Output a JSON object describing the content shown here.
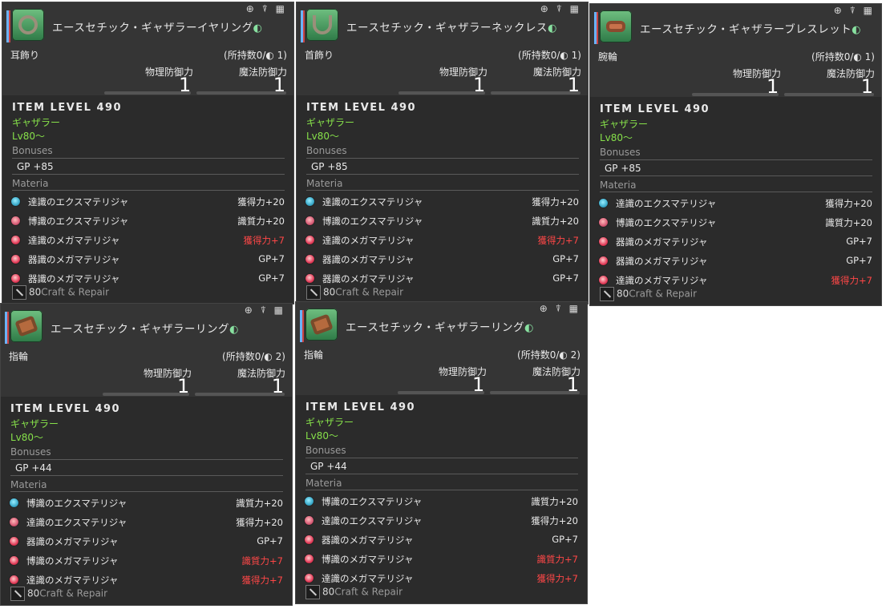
{
  "labels": {
    "phys_def": "物理防御力",
    "mag_def": "魔法防御力",
    "item_level": "ITEM LEVEL 490",
    "bonuses": "Bonuses",
    "materia": "Materia",
    "craft": "Craft & Repair",
    "tools": "⊕ ⍒ ▦"
  },
  "cards": [
    {
      "name": "エースセチック・ギャザラーイヤリング",
      "hq": "◐",
      "slot": "耳飾り",
      "owned": "(所持数0/◐ 1)",
      "phys_value": "1",
      "mag_value": "1",
      "job": "ギャザラー",
      "level": "Lv80～",
      "bonus": "GP +85",
      "craft_level": "80",
      "materia": [
        {
          "name": "達識のエクスマテリジャ",
          "value": "獲得力+20",
          "color": "blue",
          "warn": false
        },
        {
          "name": "博識のエクスマテリジャ",
          "value": "識質力+20",
          "color": "pink",
          "warn": false
        },
        {
          "name": "達識のメガマテリジャ",
          "value": "獲得力+7",
          "color": "red",
          "warn": true
        },
        {
          "name": "器識のメガマテリジャ",
          "value": "GP+7",
          "color": "red",
          "warn": false
        },
        {
          "name": "器識のメガマテリジャ",
          "value": "GP+7",
          "color": "red",
          "warn": false
        }
      ]
    },
    {
      "name": "エースセチック・ギャザラーネックレス",
      "hq": "◐",
      "slot": "首飾り",
      "owned": "(所持数0/◐ 1)",
      "phys_value": "1",
      "mag_value": "1",
      "job": "ギャザラー",
      "level": "Lv80～",
      "bonus": "GP +85",
      "craft_level": "80",
      "materia": [
        {
          "name": "達識のエクスマテリジャ",
          "value": "獲得力+20",
          "color": "blue",
          "warn": false
        },
        {
          "name": "博識のエクスマテリジャ",
          "value": "識質力+20",
          "color": "pink",
          "warn": false
        },
        {
          "name": "達識のメガマテリジャ",
          "value": "獲得力+7",
          "color": "red",
          "warn": true
        },
        {
          "name": "器識のメガマテリジャ",
          "value": "GP+7",
          "color": "red",
          "warn": false
        },
        {
          "name": "器識のメガマテリジャ",
          "value": "GP+7",
          "color": "red",
          "warn": false
        }
      ]
    },
    {
      "name": "エースセチック・ギャザラーブレスレット",
      "hq": "◐",
      "slot": "腕輪",
      "owned": "(所持数0/◐ 1)",
      "phys_value": "1",
      "mag_value": "1",
      "job": "ギャザラー",
      "level": "Lv80～",
      "bonus": "GP +85",
      "craft_level": "80",
      "materia": [
        {
          "name": "達識のエクスマテリジャ",
          "value": "獲得力+20",
          "color": "blue",
          "warn": false
        },
        {
          "name": "博識のエクスマテリジャ",
          "value": "識質力+20",
          "color": "pink",
          "warn": false
        },
        {
          "name": "器識のメガマテリジャ",
          "value": "GP+7",
          "color": "red",
          "warn": false
        },
        {
          "name": "器識のメガマテリジャ",
          "value": "GP+7",
          "color": "red",
          "warn": false
        },
        {
          "name": "達識のメガマテリジャ",
          "value": "獲得力+7",
          "color": "red",
          "warn": true
        }
      ]
    },
    {
      "name": "エースセチック・ギャザラーリング",
      "hq": "◐",
      "slot": "指輪",
      "owned": "(所持数0/◐ 2)",
      "phys_value": "1",
      "mag_value": "1",
      "job": "ギャザラー",
      "level": "Lv80～",
      "bonus": "GP +44",
      "craft_level": "80",
      "materia": [
        {
          "name": "博識のエクスマテリジャ",
          "value": "識質力+20",
          "color": "blue",
          "warn": false
        },
        {
          "name": "達識のエクスマテリジャ",
          "value": "獲得力+20",
          "color": "pink",
          "warn": false
        },
        {
          "name": "器識のメガマテリジャ",
          "value": "GP+7",
          "color": "red",
          "warn": false
        },
        {
          "name": "博識のメガマテリジャ",
          "value": "識質力+7",
          "color": "red",
          "warn": true
        },
        {
          "name": "達識のメガマテリジャ",
          "value": "獲得力+7",
          "color": "red",
          "warn": true
        }
      ]
    },
    {
      "name": "エースセチック・ギャザラーリング",
      "hq": "◐",
      "slot": "指輪",
      "owned": "(所持数0/◐ 2)",
      "phys_value": "1",
      "mag_value": "1",
      "job": "ギャザラー",
      "level": "Lv80～",
      "bonus": "GP +44",
      "craft_level": "80",
      "materia": [
        {
          "name": "博識のエクスマテリジャ",
          "value": "識質力+20",
          "color": "blue",
          "warn": false
        },
        {
          "name": "達識のエクスマテリジャ",
          "value": "獲得力+20",
          "color": "pink",
          "warn": false
        },
        {
          "name": "器識のメガマテリジャ",
          "value": "GP+7",
          "color": "red",
          "warn": false
        },
        {
          "name": "博識のメガマテリジャ",
          "value": "識質力+7",
          "color": "red",
          "warn": true
        },
        {
          "name": "達識のメガマテリジャ",
          "value": "獲得力+7",
          "color": "red",
          "warn": true
        }
      ]
    }
  ]
}
